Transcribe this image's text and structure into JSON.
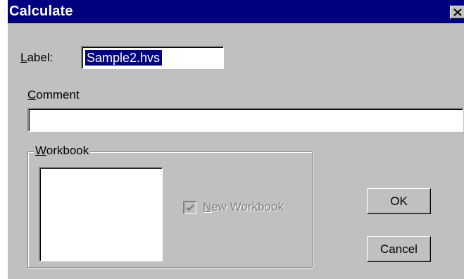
{
  "window": {
    "title": "Calculate",
    "close_icon": "close-icon"
  },
  "label_field": {
    "label_prefix": "L",
    "label_rest": "abel:",
    "value": "Sample2.hvs"
  },
  "comment_field": {
    "label_prefix": "C",
    "label_rest": "omment",
    "value": ""
  },
  "workbook_group": {
    "legend_prefix": "W",
    "legend_rest": "orkbook",
    "items": [],
    "new_workbook": {
      "label_prefix": "N",
      "label_rest": "ew Workbook",
      "checked": true,
      "enabled": false
    }
  },
  "buttons": {
    "ok": "OK",
    "cancel": "Cancel"
  },
  "colors": {
    "titlebar": "#000080",
    "face": "#c0c0c0",
    "selection": "#000080"
  }
}
